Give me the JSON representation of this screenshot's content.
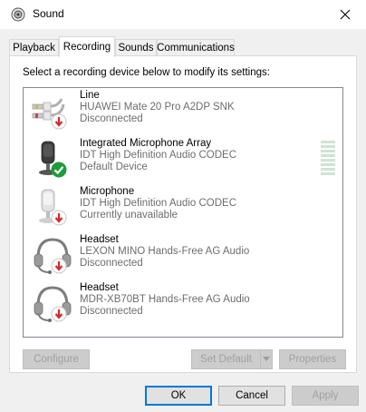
{
  "window": {
    "title": "Sound",
    "close_icon": "close-icon"
  },
  "tabs": [
    {
      "label": "Playback",
      "active": false
    },
    {
      "label": "Recording",
      "active": true
    },
    {
      "label": "Sounds",
      "active": false
    },
    {
      "label": "Communications",
      "active": false
    }
  ],
  "panel": {
    "instruction": "Select a recording device below to modify its settings:"
  },
  "devices": [
    {
      "name": "Line",
      "description": "HUAWEI Mate 20 Pro A2DP SNK",
      "status": "Disconnected",
      "icon": "line-in-jack-icon",
      "badge": "disconnected-arrow-icon"
    },
    {
      "name": "Integrated Microphone Array",
      "description": "IDT High Definition Audio CODEC",
      "status": "Default Device",
      "icon": "microphone-array-icon",
      "badge": "default-check-icon"
    },
    {
      "name": "Microphone",
      "description": "IDT High Definition Audio CODEC",
      "status": "Currently unavailable",
      "icon": "microphone-icon",
      "badge": "disconnected-arrow-icon"
    },
    {
      "name": "Headset",
      "description": "LEXON MINO Hands-Free AG Audio",
      "status": "Disconnected",
      "icon": "headset-icon",
      "badge": "disconnected-arrow-icon"
    },
    {
      "name": "Headset",
      "description": "MDR-XB70BT Hands-Free AG Audio",
      "status": "Disconnected",
      "icon": "headset-icon",
      "badge": "disconnected-arrow-icon"
    }
  ],
  "buttons": {
    "configure": "Configure",
    "set_default": "Set Default",
    "properties": "Properties",
    "ok": "OK",
    "cancel": "Cancel",
    "apply": "Apply"
  },
  "colors": {
    "accent": "#0078d7",
    "check_green": "#1e9b3a",
    "disconnect_red": "#d62a2a"
  }
}
